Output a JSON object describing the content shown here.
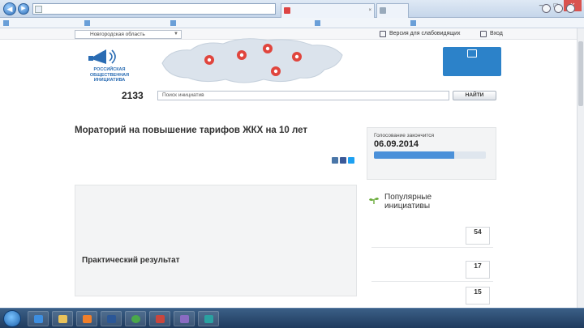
{
  "browser": {
    "address": "",
    "tabs": [
      {
        "label": ""
      },
      {
        "label": ""
      }
    ],
    "favorites": [
      {
        "label": ""
      },
      {
        "label": ""
      },
      {
        "label": ""
      },
      {
        "label": ""
      },
      {
        "label": ""
      }
    ]
  },
  "header": {
    "region": "Новгородская область",
    "links": [
      {
        "label": "Версия для слабовидящих"
      },
      {
        "label": "Вход"
      }
    ],
    "logo_text": "Российская общественная инициатива",
    "right_links": [
      "",
      "",
      ""
    ],
    "promo_text": "",
    "colors": {
      "brand_blue": "#2a6cb3",
      "promo_blue": "#2c82c9",
      "map_pin": "#e0453d",
      "green": "#2a9b2a"
    }
  },
  "search": {
    "count_label": "",
    "count": "2133",
    "placeholder": "Поиск инициатив",
    "button": "НАЙТИ"
  },
  "breadcrumb": [
    "",
    ""
  ],
  "initiative": {
    "title": "Мораторий на повышение тарифов ЖКХ на 10 лет",
    "meta": [
      "",
      "",
      "",
      "",
      ""
    ],
    "share_label": "",
    "body": [
      "",
      "",
      "",
      "",
      "",
      "",
      "",
      "",
      "",
      ""
    ],
    "result_title": "Практический результат",
    "result_body": [
      "",
      ""
    ]
  },
  "voting": {
    "label": "Голосование закончится",
    "date": "06.09.2014",
    "progress": 0.72,
    "progress_text": "",
    "link": ""
  },
  "popular": {
    "title_line1": "Популярные",
    "title_line2": "инициативы",
    "subtitle": "",
    "items": [
      {
        "text": "",
        "votes": "",
        "count": "54",
        "unit": ""
      },
      {
        "text": "",
        "votes": "",
        "count": "17",
        "unit": ""
      },
      {
        "text": "",
        "votes": "",
        "count": "15",
        "unit": ""
      }
    ]
  },
  "taskbar": {
    "time": "",
    "date": ""
  }
}
